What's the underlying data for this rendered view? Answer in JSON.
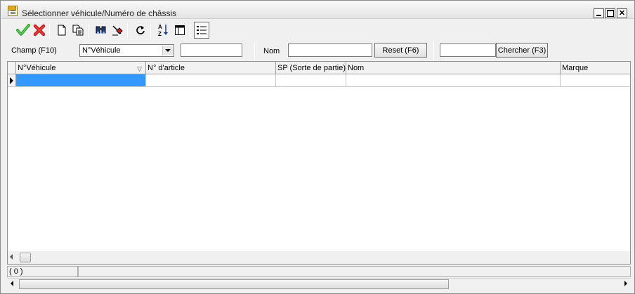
{
  "window": {
    "title": "Sélectionner véhicule/Numéro de châssis",
    "close_glyph": "✕"
  },
  "toolbar": {
    "buttons": [
      {
        "name": "confirm-icon",
        "color": "#2ea82e"
      },
      {
        "name": "cancel-icon",
        "color": "#d42020"
      },
      {
        "name": "new-document-icon"
      },
      {
        "name": "copy-document-icon"
      },
      {
        "name": "find-binoculars-icon"
      },
      {
        "name": "filter-eraser-icon"
      },
      {
        "name": "refresh-icon"
      },
      {
        "name": "sort-az-icon"
      },
      {
        "name": "columns-icon"
      },
      {
        "name": "list-view-icon"
      }
    ]
  },
  "search": {
    "field_label": "Champ (F10)",
    "field_value": "N°Véhicule",
    "name_label": "Nom",
    "reset_label": "Reset (F6)",
    "search_label": "Chercher (F3)"
  },
  "grid": {
    "columns": [
      "N°Véhicule",
      "N° d'article",
      "SP (Sorte de partie)",
      "Nom",
      "Marque"
    ],
    "sort_glyph": "▽",
    "selection_color": "#3399ff"
  },
  "status": {
    "count": "( 0 )"
  }
}
